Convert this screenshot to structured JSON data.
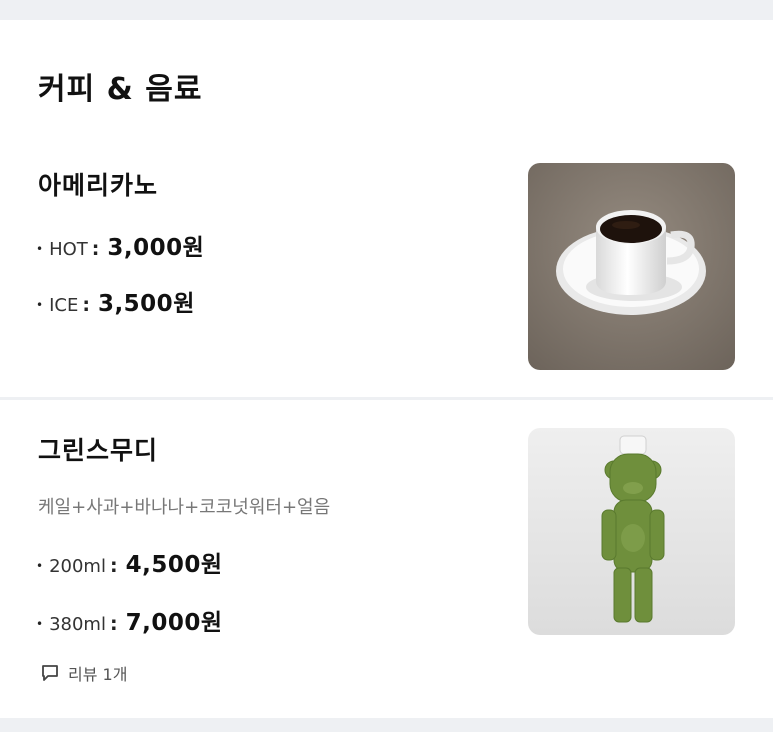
{
  "section": {
    "title": "커피 & 음료"
  },
  "items": [
    {
      "name": "아메리카노",
      "options": [
        {
          "label": "HOT",
          "price": "3,000원"
        },
        {
          "label": "ICE",
          "price": "3,500원"
        }
      ]
    },
    {
      "name": "그린스무디",
      "description": "케일+사과+바나나+코코넛워터+얼음",
      "options": [
        {
          "label": "200ml",
          "price": "4,500원"
        },
        {
          "label": "380ml",
          "price": "7,000원"
        }
      ],
      "review_label": "리뷰 1개"
    }
  ],
  "icons": {
    "review": "speech-bubble-icon"
  }
}
